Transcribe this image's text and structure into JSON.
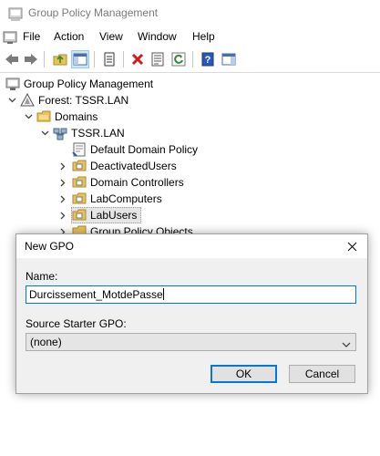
{
  "window": {
    "title": "Group Policy Management"
  },
  "menu": {
    "items": [
      "File",
      "Action",
      "View",
      "Window",
      "Help"
    ]
  },
  "toolbar": {
    "buttons": [
      "back-icon",
      "forward-icon",
      "up-folder-icon",
      "show-hide-tree-icon",
      "copy-icon",
      "delete-icon",
      "properties-icon",
      "refresh-icon",
      "help-icon",
      "show-action-pane-icon"
    ]
  },
  "tree": {
    "root": "Group Policy Management",
    "forest": "Forest: TSSR.LAN",
    "domains": "Domains",
    "domain": "TSSR.LAN",
    "items": [
      "Default Domain Policy",
      "DeactivatedUsers",
      "Domain Controllers",
      "LabComputers",
      "LabUsers",
      "Group Policy Objects"
    ]
  },
  "dialog": {
    "title": "New GPO",
    "name_label": "Name:",
    "name_value": "Durcissement_MotdePasse",
    "starter_label": "Source Starter GPO:",
    "starter_value": "(none)",
    "ok_label": "OK",
    "cancel_label": "Cancel"
  }
}
